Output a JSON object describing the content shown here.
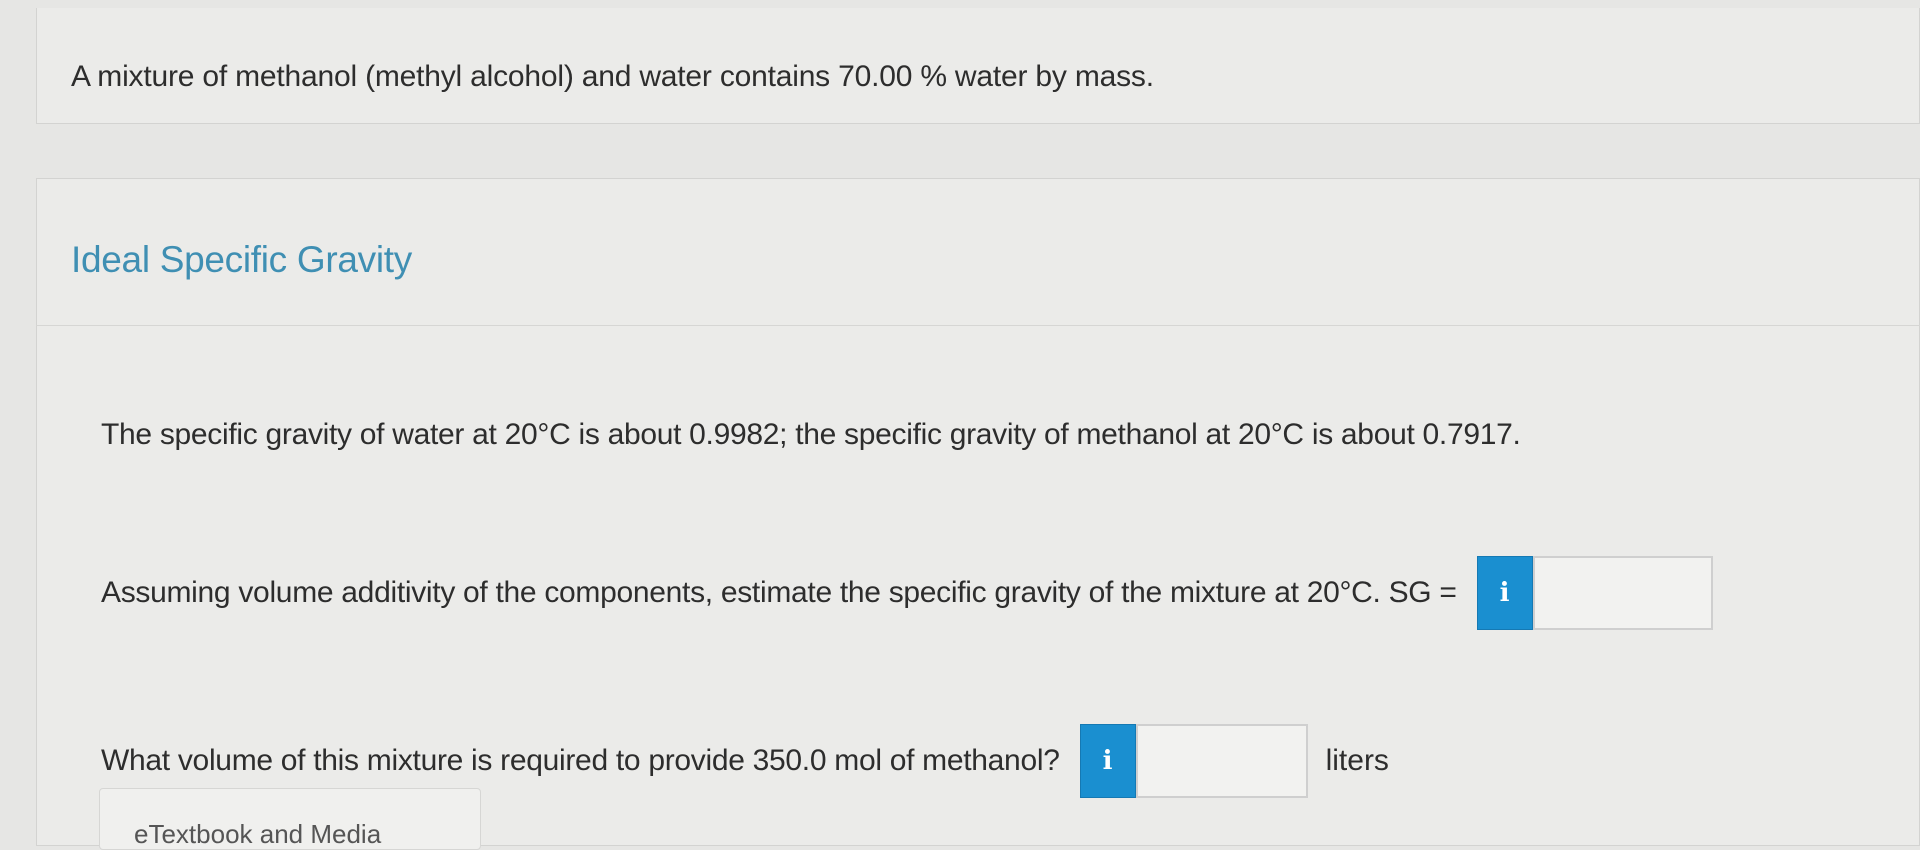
{
  "intro": {
    "text": "A mixture of methanol (methyl alcohol) and water contains 70.00 % water by mass."
  },
  "section": {
    "title": "Ideal Specific Gravity"
  },
  "body": {
    "given": "The specific gravity of water at 20°C is about 0.9982; the specific gravity of methanol at 20°C is about 0.7917.",
    "question1": "Assuming volume additivity of the components, estimate the specific gravity of the mixture at 20°C. SG =",
    "question2": "What volume of this mixture is required to provide 350.0 mol of methanol?",
    "unit2": "liters",
    "info_symbol": "i",
    "answer1_value": "",
    "answer2_value": "",
    "etextbook_label": "eTextbook and Media"
  },
  "colors": {
    "accent": "#1a8fd0",
    "title": "#3f8fb3",
    "background": "#e6e6e4"
  },
  "icons": {
    "info": "info-icon"
  }
}
